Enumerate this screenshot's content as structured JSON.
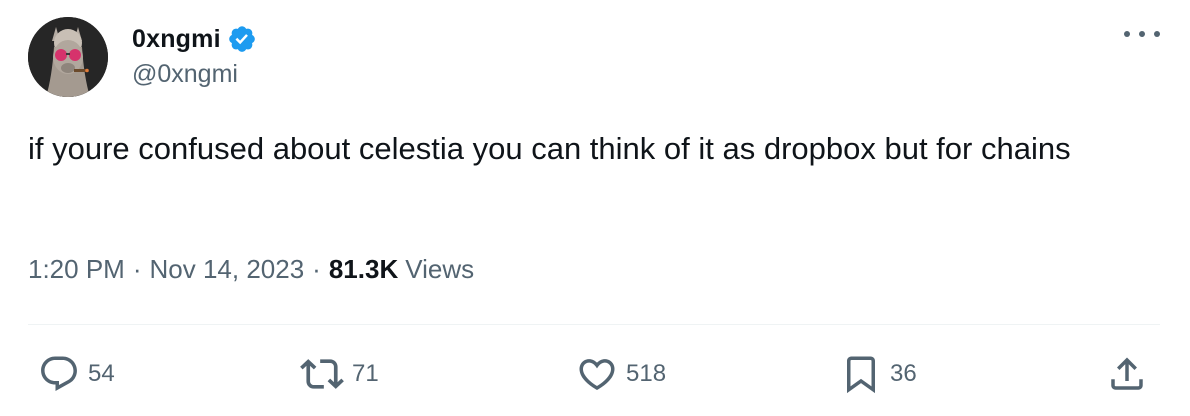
{
  "author": {
    "display_name": "0xngmi",
    "handle": "@0xngmi",
    "verified": true,
    "verified_color": "#1d9bf0"
  },
  "tweet": {
    "text": "if youre confused about celestia you can think of it as dropbox but for chains",
    "time": "1:20 PM",
    "separator": "·",
    "date": "Nov 14, 2023",
    "views_count": "81.3K",
    "views_label": "Views"
  },
  "actions": {
    "replies": "54",
    "retweets": "71",
    "likes": "518",
    "bookmarks": "36"
  },
  "icons": {
    "more": "more-options-icon",
    "reply": "reply-icon",
    "retweet": "retweet-icon",
    "like": "heart-icon",
    "bookmark": "bookmark-icon",
    "share": "share-icon"
  },
  "colors": {
    "text": "#0f1419",
    "secondary": "#536471",
    "divider": "#eff3f4"
  }
}
